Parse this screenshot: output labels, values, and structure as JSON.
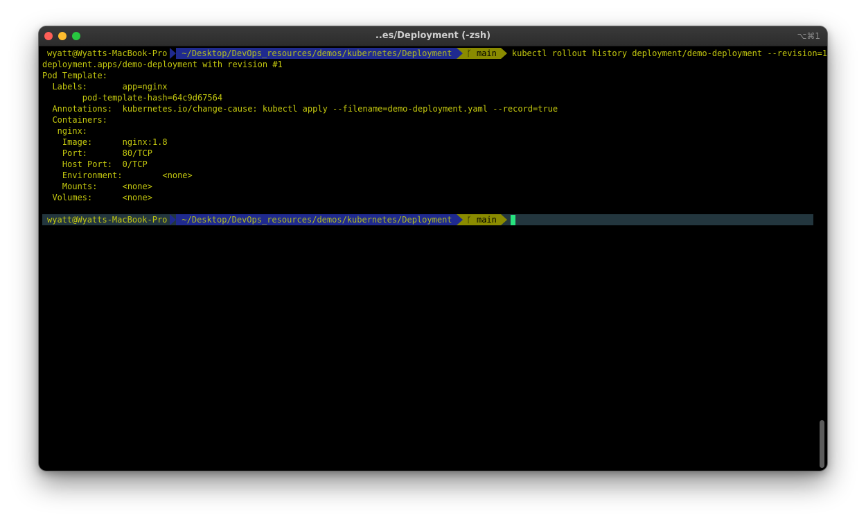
{
  "window": {
    "title": "..es/Deployment (-zsh)",
    "shortcut": "⌥⌘1"
  },
  "prompt": {
    "user_host": "wyatt@Wyatts-MacBook-Pro",
    "path": "~/Desktop/DevOps_resources/demos/kubernetes/Deployment",
    "branch_icon": "git-branch-icon",
    "branch": "main"
  },
  "command": "kubectl rollout history deployment/demo-deployment --revision=1",
  "output": [
    "deployment.apps/demo-deployment with revision #1",
    "Pod Template:",
    "  Labels:       app=nginx",
    "        pod-template-hash=64c9d67564",
    "  Annotations:  kubernetes.io/change-cause: kubectl apply --filename=demo-deployment.yaml --record=true",
    "  Containers:",
    "   nginx:",
    "    Image:      nginx:1.8",
    "    Port:       80/TCP",
    "    Host Port:  0/TCP",
    "    Environment:        <none>",
    "    Mounts:     <none>",
    "  Volumes:      <none>",
    ""
  ],
  "colors": {
    "terminal_bg": "#000000",
    "text": "#c5c90f",
    "path_bg": "#1f2a8f",
    "git_bg": "#8a8b00",
    "active_line_bg": "#23363e",
    "cursor": "#27e27e"
  }
}
